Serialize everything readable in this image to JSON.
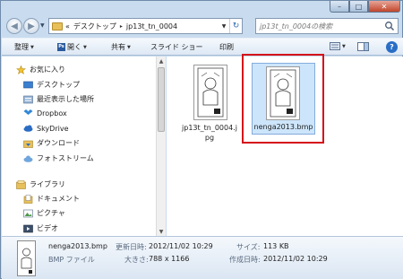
{
  "window": {
    "caption_buttons": {
      "minimize": "–",
      "maximize": "□",
      "close": "✕"
    }
  },
  "address": {
    "prefix": "«",
    "crumbs": [
      "デスクトップ",
      "jp13t_tn_0004"
    ],
    "separator": "▸"
  },
  "search": {
    "placeholder": "jp13t_tn_0004の検索"
  },
  "toolbar": {
    "organize": "整理",
    "open": "開く",
    "share": "共有",
    "slideshow": "スライド ショー",
    "print": "印刷",
    "help": "?"
  },
  "nav": {
    "favorites": {
      "title": "お気に入り",
      "items": [
        "デスクトップ",
        "最近表示した場所",
        "Dropbox",
        "SkyDrive",
        "ダウンロード",
        "フォトストリーム"
      ]
    },
    "libraries": {
      "title": "ライブラリ",
      "items": [
        "ドキュメント",
        "ピクチャ",
        "ビデオ"
      ]
    }
  },
  "files": [
    {
      "name_line1": "jp13t_tn_0004.j",
      "name_line2": "pg"
    },
    {
      "name": "nenga2013.bmp"
    }
  ],
  "details": {
    "filename": "nenga2013.bmp",
    "filetype": "BMP ファイル",
    "modified_label": "更新日時:",
    "modified_value": "2012/11/02 10:29",
    "size_label": "サイズ:",
    "size_value": "113 KB",
    "dimensions_label": "大きさ:",
    "dimensions_value": "788 x 1166",
    "created_label": "作成日時:",
    "created_value": "2012/11/02 10:29"
  },
  "colors": {
    "selection": "#cde5fb",
    "highlight_outline": "#d50f1a",
    "window_frame": "#c9dcef"
  }
}
